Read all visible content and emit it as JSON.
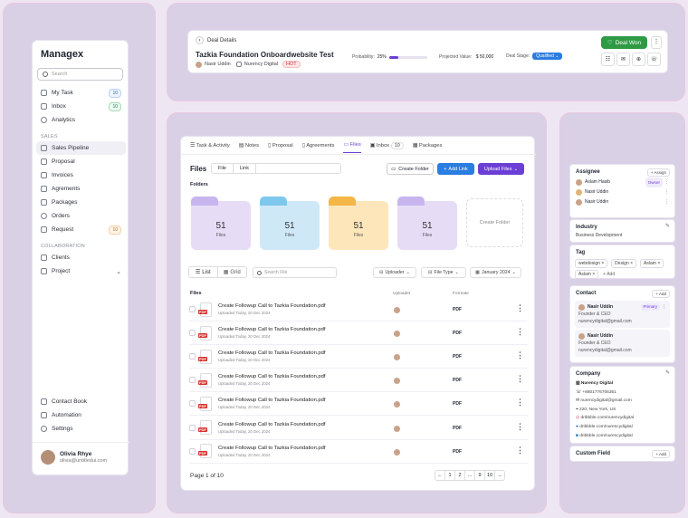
{
  "sidebar": {
    "logo": "Managex",
    "search_placeholder": "Search",
    "items": [
      {
        "label": "My Task",
        "count": "10"
      },
      {
        "label": "Inbox",
        "count": "10"
      },
      {
        "label": "Analytics"
      }
    ],
    "sales_header": "SALES",
    "sales_items": [
      {
        "label": "Sales Pipeline"
      },
      {
        "label": "Proposal"
      },
      {
        "label": "Invoices"
      },
      {
        "label": "Agrements"
      },
      {
        "label": "Packages"
      },
      {
        "label": "Orders"
      },
      {
        "label": "Request",
        "count": "10"
      }
    ],
    "collab_header": "COLLABORATION",
    "collab_items": [
      {
        "label": "Clients"
      },
      {
        "label": "Project"
      }
    ],
    "bottom_items": [
      {
        "label": "Contact Book"
      },
      {
        "label": "Automation"
      },
      {
        "label": "Settings"
      }
    ],
    "user": {
      "name": "Olivia Rhye",
      "email": "olivia@untitledui.com"
    }
  },
  "deal": {
    "back_label": "Deal Details",
    "title": "Tazkia Foundation Onboardwebsite Test",
    "owner": "Nasir Uddin",
    "company": "Nurency Digital",
    "tag": "HOT",
    "probability_label": "Probability:",
    "probability_value": "25%",
    "probability": 0.25,
    "projected_label": "Projected Value:",
    "projected_value": "$ 50,000",
    "stage_label": "Deal Stage:",
    "stage_value": "Qualified",
    "won_button": "Deal Won"
  },
  "tabs": [
    {
      "label": "Task & Activity"
    },
    {
      "label": "Notes"
    },
    {
      "label": "Proposal"
    },
    {
      "label": "Agreements"
    },
    {
      "label": "Files"
    },
    {
      "label": "Inbox",
      "count": "10"
    },
    {
      "label": "Packages"
    }
  ],
  "files": {
    "title": "Files",
    "seg_file": "File",
    "seg_link": "Link",
    "create_folder": "Create Folder",
    "add_link": "Add Link",
    "upload_files": "Upload Files",
    "folders_label": "Folders",
    "folders": [
      {
        "count": "51",
        "label": "Files"
      },
      {
        "count": "51",
        "label": "Files"
      },
      {
        "count": "51",
        "label": "Files"
      },
      {
        "count": "51",
        "label": "Files"
      }
    ],
    "create_folder_tile": "Create Folder",
    "view_list": "List",
    "view_grid": "Grid",
    "search_placeholder": "Search File",
    "filter_uploader": "Uploader",
    "filter_type": "File Type",
    "filter_date": "January 2024",
    "col_files": "Files",
    "col_uploader": "Uploader",
    "col_formate": "Formate",
    "rows": [
      {
        "name": "Create Followup Call to Tazkia Foundation.pdf",
        "meta": "Uploaded Today, 20 Dec 2024",
        "format": "PDF"
      },
      {
        "name": "Create Followup Call to Tazkia Foundation.pdf",
        "meta": "Uploaded Today, 20 Dec 2024",
        "format": "PDF"
      },
      {
        "name": "Create Followup Call to Tazkia Foundation.pdf",
        "meta": "Uploaded Today, 20 Dec 2024",
        "format": "PDF"
      },
      {
        "name": "Create Followup Call to Tazkia Foundation.pdf",
        "meta": "Uploaded Today, 20 Dec 2024",
        "format": "PDF"
      },
      {
        "name": "Create Followup Call to Tazkia Foundation.pdf",
        "meta": "Uploaded Today, 20 Dec 2024",
        "format": "PDF"
      },
      {
        "name": "Create Followup Call to Tazkia Foundation.pdf",
        "meta": "Uploaded Today, 20 Dec 2024",
        "format": "PDF"
      },
      {
        "name": "Create Followup Call to Tazkia Foundation.pdf",
        "meta": "Uploaded Today, 20 Dec 2024",
        "format": "PDF"
      }
    ],
    "page_info": "Page 1 of 10",
    "pages": [
      "1",
      "2",
      "...",
      "9",
      "10"
    ]
  },
  "right": {
    "assignee_title": "Assignee",
    "assign_button": "+ Assign",
    "assignees": [
      {
        "name": "Aslam Hasib",
        "badge": "Owner"
      },
      {
        "name": "Nasir Uddin"
      },
      {
        "name": "Nasir Uddin"
      }
    ],
    "industry_title": "Industry",
    "industry_value": "Business Development",
    "tag_title": "Tag",
    "tags": [
      "webdesign",
      "Design",
      "Aslam",
      "Aslam"
    ],
    "add_tag": "+ Add",
    "contact_title": "Contact",
    "contact_add": "+ Add",
    "contacts": [
      {
        "name": "Nasir Uddin",
        "badge": "Primary",
        "role": "Founder & CEO",
        "email": "nurencydigital@gmail.com"
      },
      {
        "name": "Nasir Uddin",
        "role": "Founder & CEO",
        "email": "nurencydigital@gmail.com"
      }
    ],
    "company_title": "Company",
    "company_lines": [
      "Nurency Digital",
      "+8801776706361",
      "nurencydigital@gmail.com",
      "220, New York, US",
      "dribbble.com/nurencydigital",
      "dribbble.com/nurencydigital",
      "dribbble.com/nurencydigital"
    ],
    "custom_title": "Custom Field",
    "custom_add": "+ Add"
  },
  "colors": {
    "accent": "#6b3fd6",
    "won": "#2e9b44",
    "stage": "#2a7de1"
  }
}
